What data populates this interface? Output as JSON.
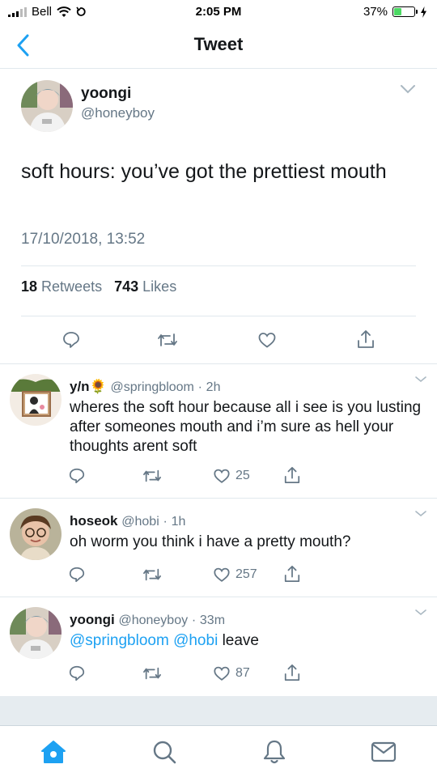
{
  "status_bar": {
    "carrier": "Bell",
    "time": "2:05 PM",
    "battery": "37%",
    "battery_level": 0.37
  },
  "nav": {
    "title": "Tweet",
    "back_icon": "chevron-left-icon"
  },
  "main_tweet": {
    "name": "yoongi",
    "handle": "@honeyboy",
    "text": "soft hours: you’ve got the prettiest mouth",
    "timestamp": "17/10/2018, 13:52",
    "retweets_count": "18",
    "retweets_label": "Retweets",
    "likes_count": "743",
    "likes_label": "Likes"
  },
  "replies": [
    {
      "name": "y/n",
      "emoji": "🌻",
      "handle": "@springbloom",
      "time": "2h",
      "text": "wheres the soft hour because all i see is you lusting after someones mouth and i’m sure as hell your thoughts arent soft",
      "likes": "25"
    },
    {
      "name": "hoseok",
      "handle": "@hobi",
      "time": "1h",
      "text": "oh worm you think i have a pretty mouth?",
      "likes": "257"
    },
    {
      "name": "yoongi",
      "handle": "@honeyboy",
      "time": "33m",
      "mention1": "@springbloom",
      "mention2": "@hobi",
      "text": "leave",
      "likes": "87"
    }
  ],
  "separator": "·",
  "colors": {
    "accent": "#1da1f2",
    "secondary_text": "#657786",
    "divider": "#e1e8ed",
    "battery_fill": "#4cd964"
  },
  "tabs": [
    "home-icon",
    "search-icon",
    "notifications-icon",
    "messages-icon"
  ]
}
